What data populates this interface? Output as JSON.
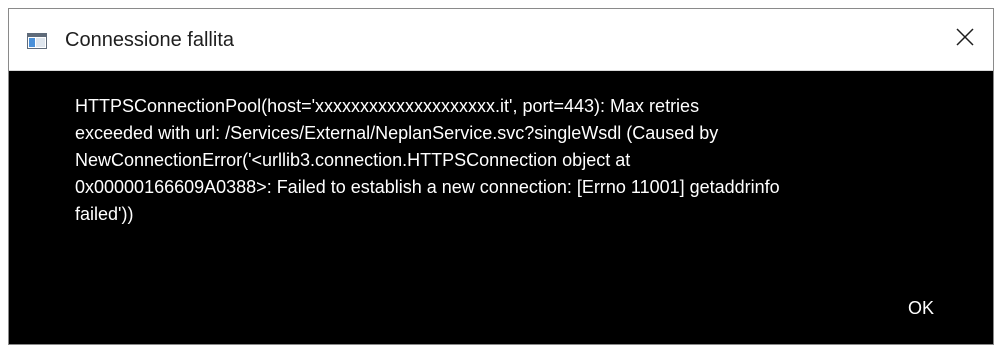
{
  "window": {
    "title": "Connessione fallita",
    "icon": "app-window-icon",
    "close_icon": "close-icon"
  },
  "dialog": {
    "message": "HTTPSConnectionPool(host='xxxxxxxxxxxxxxxxxxxx.it', port=443): Max retries\nexceeded with url: /Services/External/NeplanService.svc?singleWsdl (Caused by\nNewConnectionError('<urllib3.connection.HTTPSConnection object at\n0x00000166609A0388>: Failed to establish a new connection: [Errno 11001] getaddrinfo\nfailed'))",
    "ok_label": "OK"
  },
  "colors": {
    "body_background": "#000000",
    "titlebar_background": "#ffffff",
    "text": "#ffffff"
  }
}
